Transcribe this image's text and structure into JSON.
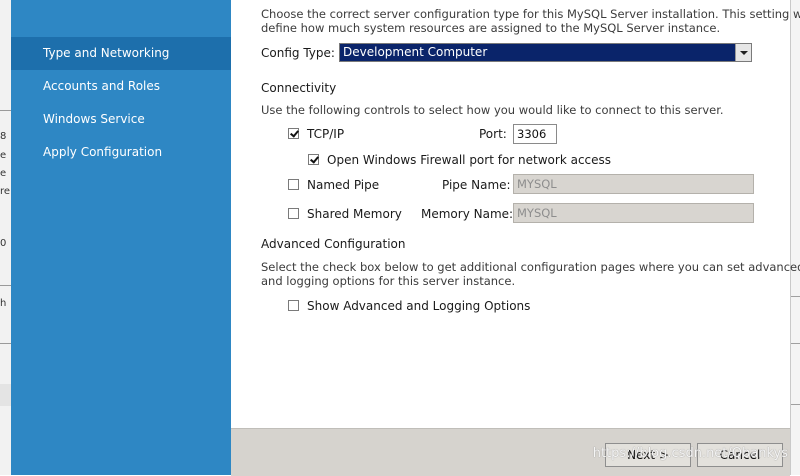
{
  "background_window": {
    "left_fragments": [
      "8",
      "e",
      "e",
      "re",
      "0",
      "h"
    ]
  },
  "sidebar": {
    "items": [
      {
        "label": "Type and Networking",
        "active": true
      },
      {
        "label": "Accounts and Roles",
        "active": false
      },
      {
        "label": "Windows Service",
        "active": false
      },
      {
        "label": "Apply Configuration",
        "active": false
      }
    ]
  },
  "config": {
    "description_line1": "Choose the correct server configuration type for this MySQL Server installation. This setting will",
    "description_line2": "define how much system resources are assigned to the MySQL Server instance.",
    "type_label": "Config Type:",
    "type_value": "Development Computer"
  },
  "connectivity": {
    "heading": "Connectivity",
    "description": "Use the following controls to select how you would like to connect to this server.",
    "tcpip": {
      "label": "TCP/IP",
      "checked": true,
      "port_label": "Port:",
      "port_value": "3306"
    },
    "firewall": {
      "label": "Open Windows Firewall port for network access",
      "checked": true
    },
    "named_pipe": {
      "label": "Named Pipe",
      "checked": false,
      "name_label": "Pipe Name:",
      "name_value": "MYSQL"
    },
    "shared_memory": {
      "label": "Shared Memory",
      "checked": false,
      "name_label": "Memory Name:",
      "name_value": "MYSQL"
    }
  },
  "advanced": {
    "heading": "Advanced Configuration",
    "description_line1": "Select the check box below to get additional configuration pages where you can set advanced",
    "description_line2": "and logging options for this server instance.",
    "checkbox_label": "Show Advanced and Logging Options",
    "checked": false
  },
  "footer": {
    "next_label": "Next >",
    "cancel_label": "Cancel"
  },
  "watermark": "https://blog.csdn.net/Qbankys",
  "colors": {
    "sidebar": "#2e87c4",
    "sidebar_active": "#1d6fac",
    "select_bg": "#0a246a",
    "footer": "#d6d3ce"
  }
}
